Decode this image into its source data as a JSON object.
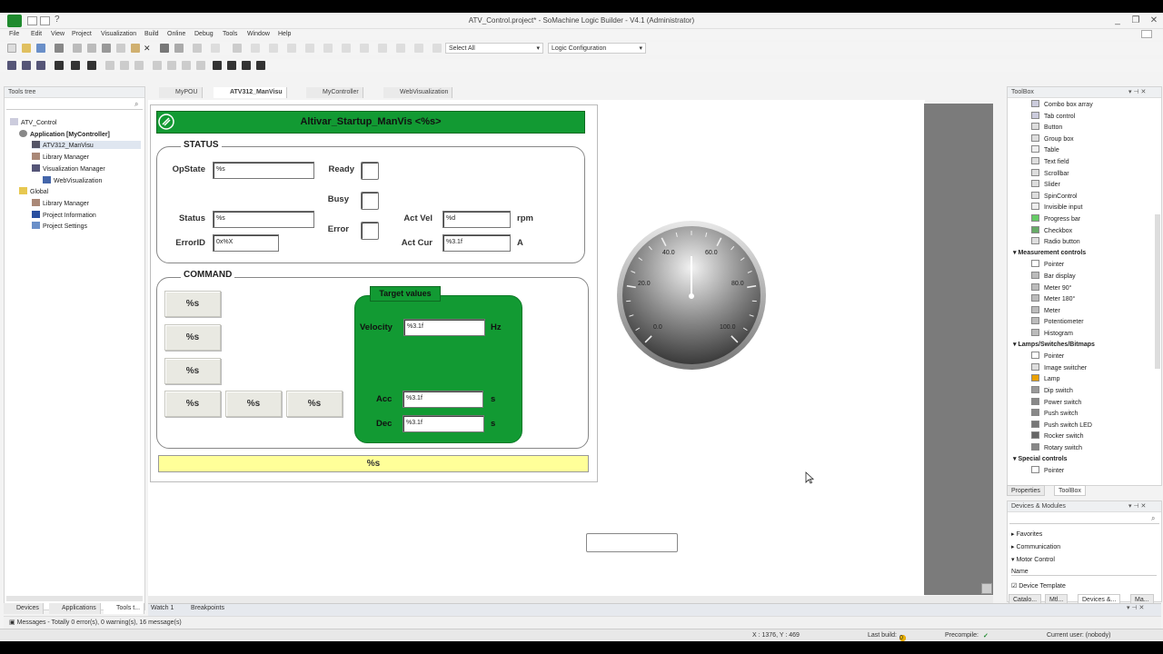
{
  "window": {
    "title": "ATV_Control.project* - SoMachine Logic Builder - V4.1 (Administrator)",
    "minimize": "_",
    "maximize": "❐",
    "close": "✕"
  },
  "menu": [
    "File",
    "Edit",
    "View",
    "Project",
    "Visualization",
    "Build",
    "Online",
    "Debug",
    "Tools",
    "Window",
    "Help"
  ],
  "toolbar": {
    "select_all": "Select All",
    "logic_configuration": "Logic Configuration"
  },
  "tools_tree": {
    "title": "Tools tree",
    "items": [
      {
        "label": "ATV_Control",
        "bold": false
      },
      {
        "label": "Application [MyController]",
        "bold": true
      },
      {
        "label": "ATV312_ManVisu",
        "bold": false
      },
      {
        "label": "Library Manager",
        "bold": false
      },
      {
        "label": "Visualization Manager",
        "bold": false
      },
      {
        "label": "WebVisualization",
        "bold": false
      },
      {
        "label": "Global",
        "bold": false
      },
      {
        "label": "Library Manager",
        "bold": false
      },
      {
        "label": "Project Information",
        "bold": false
      },
      {
        "label": "Project Settings",
        "bold": false
      }
    ],
    "bottom_tabs": [
      "Devices",
      "Applications",
      "Tools t..."
    ]
  },
  "editor_tabs": [
    "MyPOU",
    "ATV312_ManVisu",
    "MyController",
    "WebVisualization"
  ],
  "vis": {
    "header": "Altivar_Startup_ManVis <%s>",
    "status_label": "STATUS",
    "command_label": "COMMAND",
    "opstate_label": "OpState",
    "opstate_value": "%s",
    "status_field_label": "Status",
    "status_value": "%s",
    "errorid_label": "ErrorID",
    "errorid_value": "0x%X",
    "ready_label": "Ready",
    "busy_label": "Busy",
    "error_label": "Error",
    "actvel_label": "Act Vel",
    "actvel_value": "%d",
    "actvel_unit": "rpm",
    "actcur_label": "Act Cur",
    "actcur_value": "%3.1f",
    "actcur_unit": "A",
    "buttons": [
      "%s",
      "%s",
      "%s",
      "%s",
      "%s",
      "%s"
    ],
    "target_label": "Target values",
    "velocity_label": "Velocity",
    "velocity_value": "%3.1f",
    "velocity_unit": "Hz",
    "acc_label": "Acc",
    "acc_value": "%3.1f",
    "acc_unit": "s",
    "dec_label": "Dec",
    "dec_value": "%3.1f",
    "dec_unit": "s",
    "footer_text": "%s"
  },
  "gauge": {
    "labels": [
      "0.0",
      "20.0",
      "40.0",
      "60.0",
      "80.0",
      "100.0"
    ],
    "value": 50
  },
  "toolbox": {
    "title": "ToolBox",
    "items_a": [
      "Combo box array",
      "Tab control",
      "Button",
      "Group box",
      "Table",
      "Text field",
      "Scrollbar",
      "Slider",
      "SpinControl",
      "Invisible input",
      "Progress bar",
      "Checkbox",
      "Radio button"
    ],
    "cat_measure": "Measurement controls",
    "items_b": [
      "Pointer",
      "Bar display",
      "Meter 90°",
      "Meter 180°",
      "Meter",
      "Potentiometer",
      "Histogram"
    ],
    "cat_lamps": "Lamps/Switches/Bitmaps",
    "items_c": [
      "Pointer",
      "Image switcher",
      "Lamp",
      "Dip switch",
      "Power switch",
      "Push switch",
      "Push switch LED",
      "Rocker switch",
      "Rotary switch"
    ],
    "cat_special": "Special controls",
    "items_d": [
      "Pointer"
    ],
    "tabs": [
      "Properties",
      "ToolBox"
    ]
  },
  "devices": {
    "title": "Devices & Modules",
    "cats": [
      "Favorites",
      "Communication",
      "Motor Control"
    ],
    "name_col": "Name",
    "device_template": "Device Template",
    "tabs": [
      "Catalo...",
      "Mtl...",
      "Devices &...",
      "Ma..."
    ]
  },
  "bottom": {
    "tabs": [
      "Watch 1",
      "Breakpoints"
    ],
    "messages": "Messages - Totally 0 error(s), 0 warning(s), 16 message(s)",
    "coords": "X : 1376, Y : 469",
    "last_build": "Last build:",
    "zeros": [
      "0",
      "0"
    ],
    "precompile": "Precompile:",
    "current_user": "Current user: (nobody)"
  }
}
